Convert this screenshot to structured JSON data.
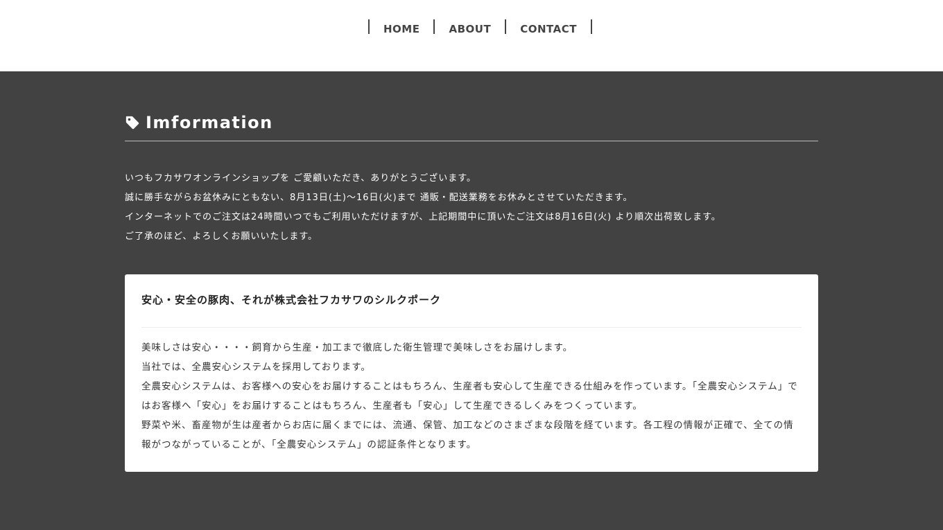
{
  "nav": {
    "items": [
      {
        "label": "HOME"
      },
      {
        "label": "ABOUT"
      },
      {
        "label": "CONTACT"
      }
    ]
  },
  "section": {
    "icon": "tag-icon",
    "title": "Imformation"
  },
  "notice": {
    "lines": [
      "いつもフカサワオンラインショップを ご愛顧いただき、ありがとうございます。",
      "誠に勝手ながらお盆休みにともない、8月13日(土)〜16日(火)まで 通販・配送業務をお休みとさせていただきます。",
      "インターネットでのご注文は24時間いつでもご利用いただけますが、上記期間中に頂いたご注文は8月16日(火) より順次出荷致します。",
      "ご了承のほど、よろしくお願いいたします。"
    ]
  },
  "card": {
    "title": "安心・安全の豚肉、それが株式会社フカサワのシルクポーク",
    "paragraphs": [
      "美味しさは安心・・・・飼育から生産・加工まで徹底した衛生管理で美味しさをお届けします。",
      "当社では、全農安心システムを採用しております。",
      "全農安心システムは、お客様への安心をお届けすることはもちろん、生産者も安心して生産できる仕組みを作っています。「全農安心システム」ではお客様へ「安心」をお届けすることはもちろん、生産者も「安心」して生産できるしくみをつくっています。",
      "野菜や米、畜産物が生は産者からお店に届くまでには、流通、保管、加工などのさまざまな段階を経ています。各工程の情報が正確で、全ての情報がつながっていることが、「全農安心システム」の認証条件となります。"
    ]
  },
  "colors": {
    "header_bg": "#ffffff",
    "main_bg": "#424242",
    "card_bg": "#ffffff",
    "nav_text": "#444444",
    "notice_text": "#ffffff",
    "card_text": "#333333"
  }
}
